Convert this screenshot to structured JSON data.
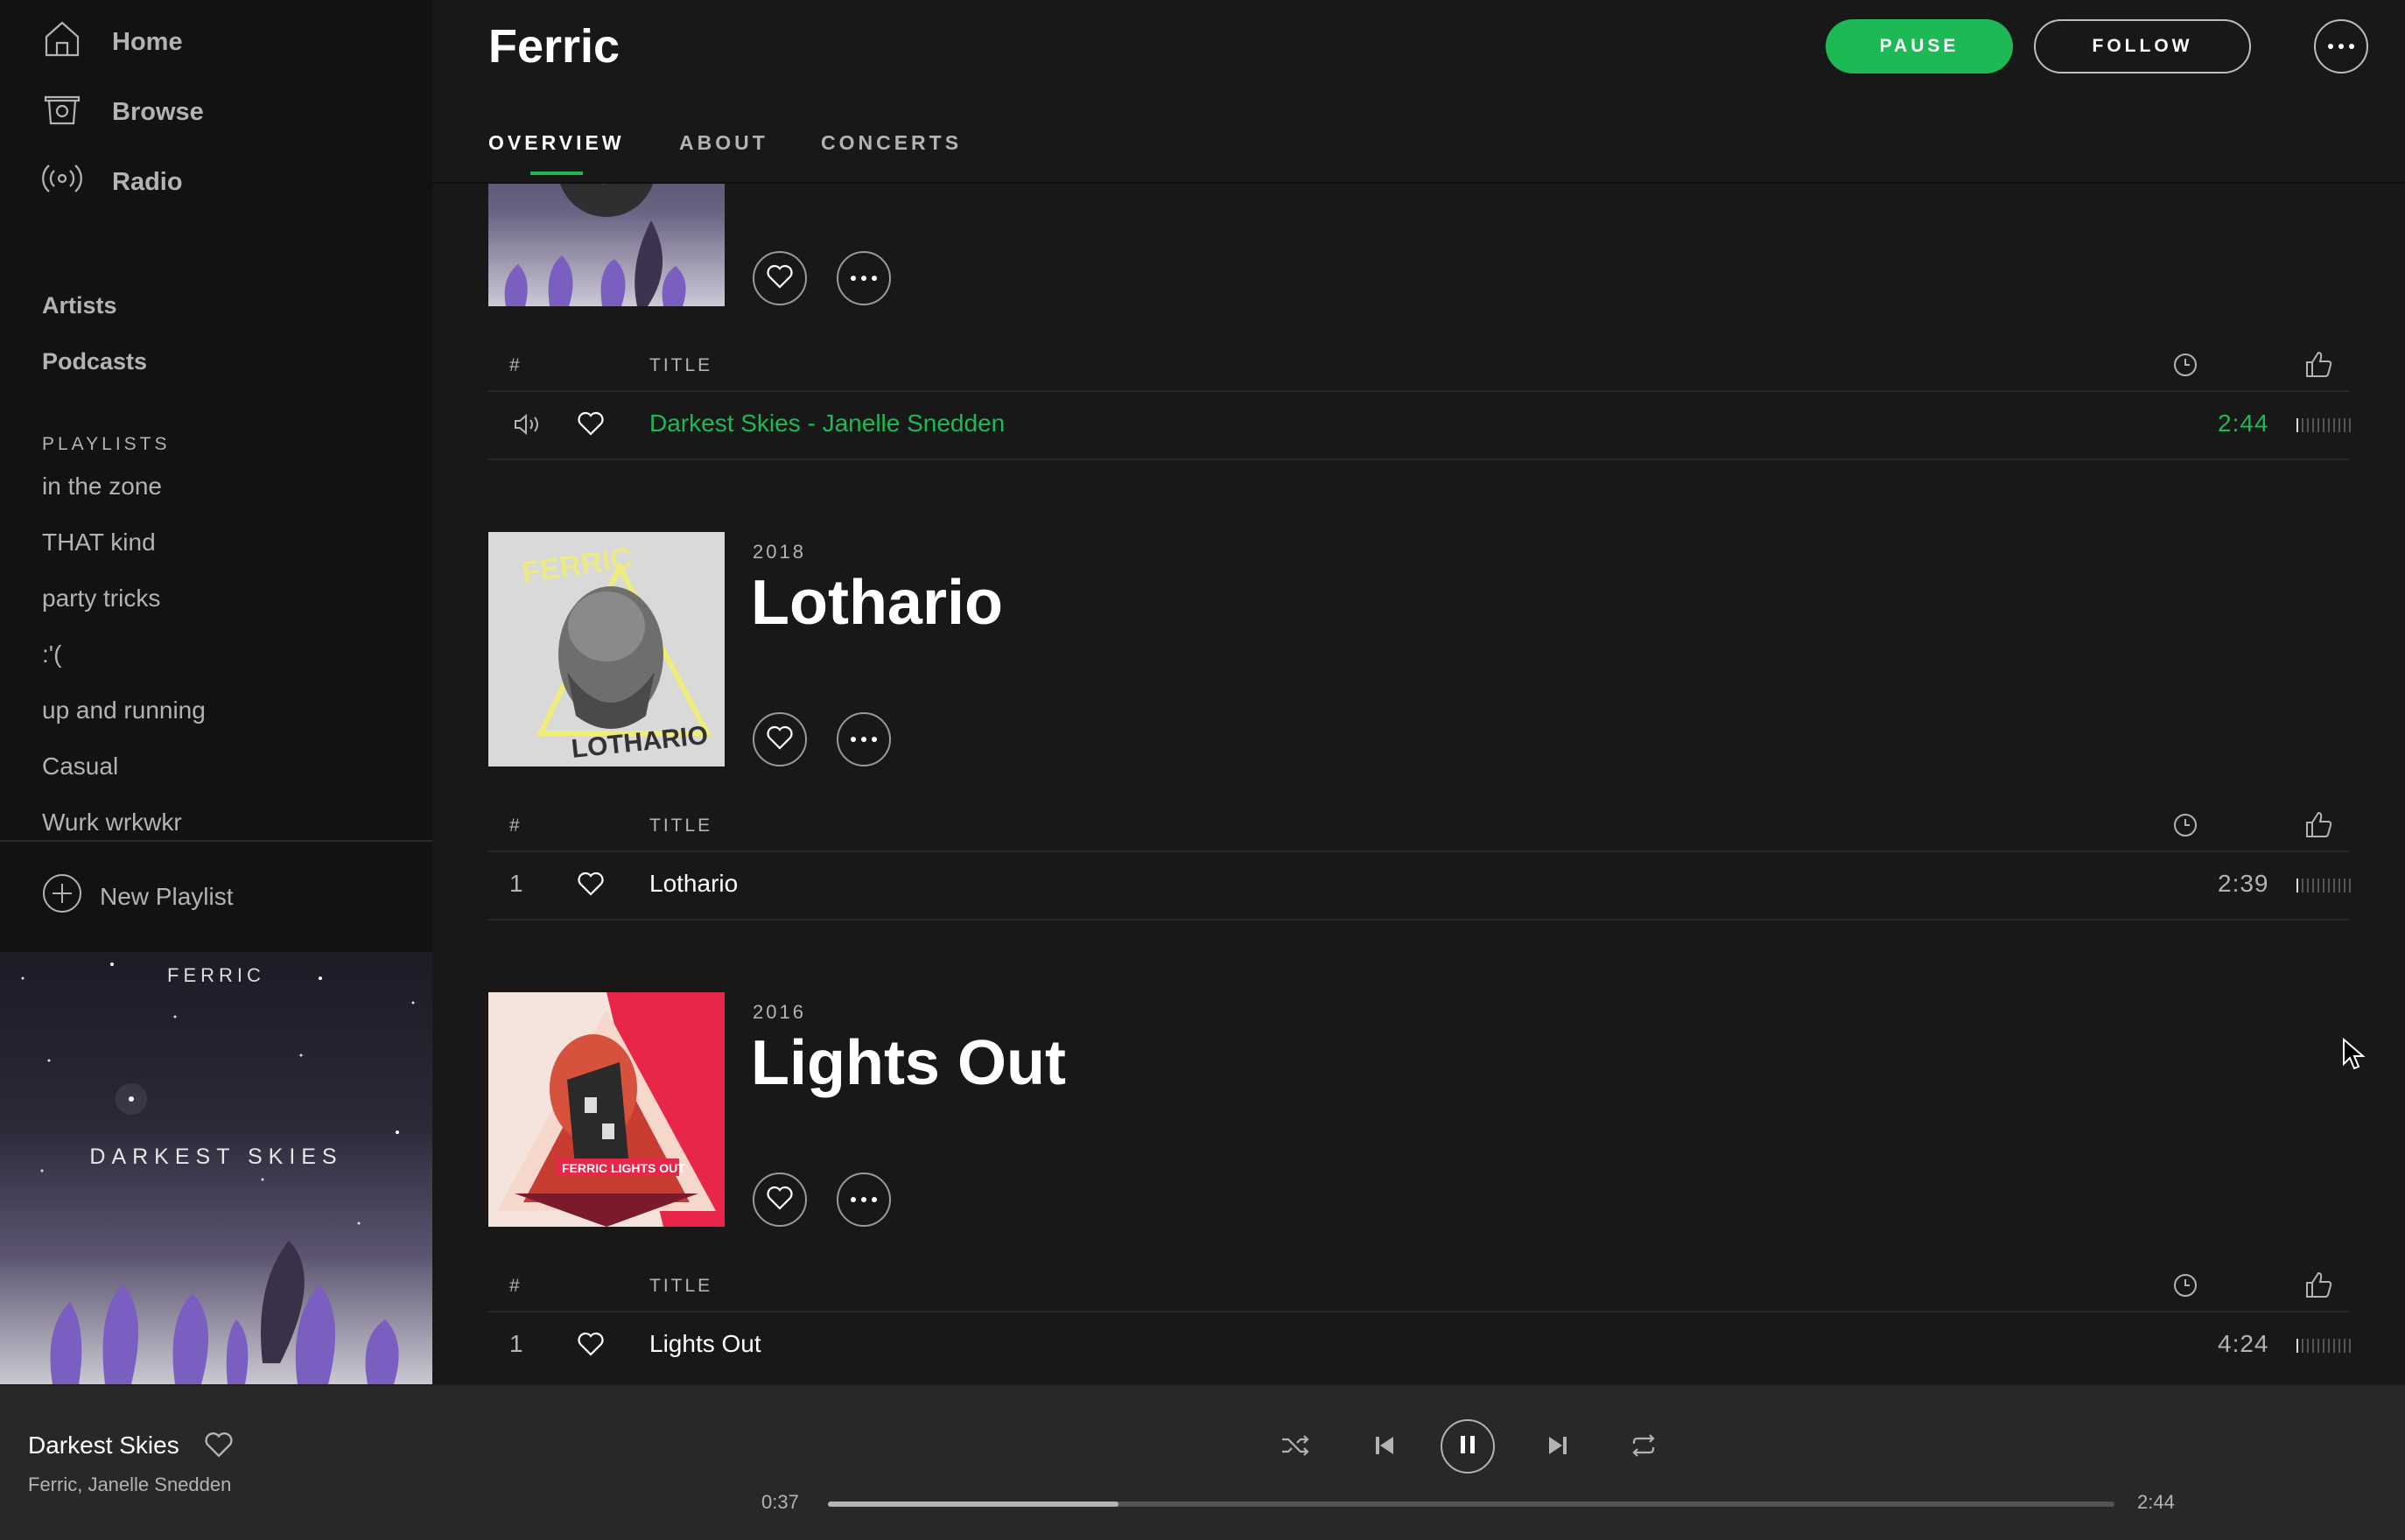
{
  "sidebar": {
    "nav": [
      {
        "label": "Home",
        "icon": "home-icon"
      },
      {
        "label": "Browse",
        "icon": "browse-icon"
      },
      {
        "label": "Radio",
        "icon": "radio-icon"
      }
    ],
    "library": [
      "Artists",
      "Podcasts"
    ],
    "playlists_header": "PLAYLISTS",
    "playlists": [
      "in the zone",
      "THAT kind",
      "party tricks",
      ":'(",
      "up and running",
      "Casual",
      "Wurk wrkwkr"
    ],
    "new_playlist": "New Playlist",
    "cover_art": {
      "artist": "FERRIC",
      "title": "DARKEST SKIES"
    }
  },
  "header": {
    "artist": "Ferric",
    "pause_label": "PAUSE",
    "follow_label": "FOLLOW",
    "tabs": [
      "OVERVIEW",
      "ABOUT",
      "CONCERTS"
    ],
    "active_tab": "OVERVIEW"
  },
  "columns": {
    "num": "#",
    "title": "TITLE"
  },
  "albums": [
    {
      "year": "",
      "title": "",
      "tracks": [
        {
          "num": "",
          "title": "Darkest Skies - Janelle Snedden",
          "duration": "2:44",
          "popularity": 0.1,
          "playing": true
        }
      ]
    },
    {
      "year": "2018",
      "title": "Lothario",
      "cover_text": "LOTHARIO",
      "cover_brand": "FERRIC",
      "tracks": [
        {
          "num": "1",
          "title": "Lothario",
          "duration": "2:39",
          "popularity": 0.0,
          "playing": false
        }
      ]
    },
    {
      "year": "2016",
      "title": "Lights Out",
      "cover_text": "FERRIC LIGHTS OUT",
      "tracks": [
        {
          "num": "1",
          "title": "Lights Out",
          "duration": "4:24",
          "popularity": 0.0,
          "playing": false
        }
      ]
    }
  ],
  "player": {
    "title": "Darkest Skies",
    "artist": "Ferric, Janelle Snedden",
    "elapsed": "0:37",
    "total": "2:44",
    "progress": 0.226
  },
  "colors": {
    "accent": "#1db954",
    "background": "#181818",
    "sidebar": "#121212",
    "player": "#282828"
  }
}
